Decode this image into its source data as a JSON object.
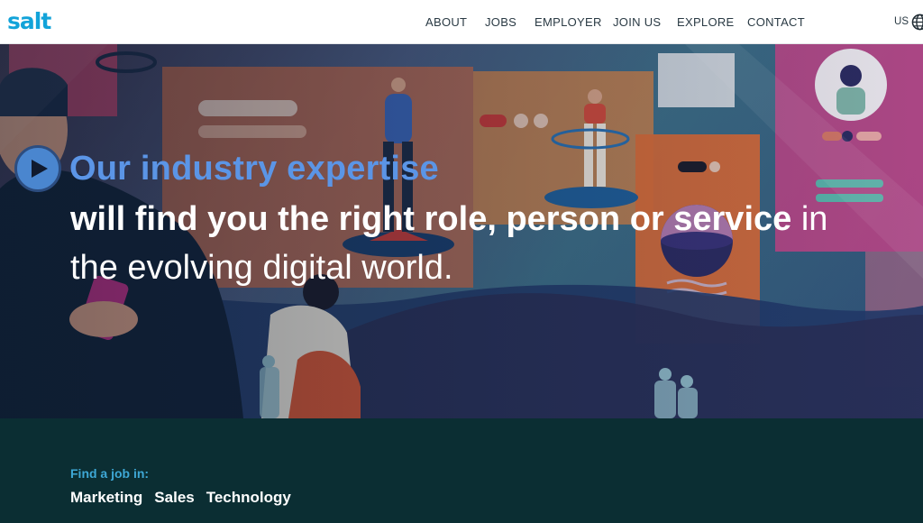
{
  "brand": {
    "logo_text": "salt",
    "color": "#12a3d9"
  },
  "nav": {
    "items": [
      {
        "label": "ABOUT"
      },
      {
        "label": "JOBS"
      },
      {
        "label": "EMPLOYER"
      },
      {
        "label": "JOIN US"
      },
      {
        "label": "EXPLORE"
      },
      {
        "label": "CONTACT"
      }
    ],
    "region_label": "US",
    "region_icon": "globe-icon"
  },
  "hero": {
    "play_icon": "play-icon",
    "headline_accent": "Our industry expertise",
    "headline_bold": "will find you the right role, person or service",
    "headline_rest": " in",
    "headline_line3": "the evolving digital world.",
    "accent_color": "#5b95e6"
  },
  "jobs_band": {
    "find_label": "Find a job in:",
    "links": [
      {
        "label": "Marketing"
      },
      {
        "label": "Sales"
      },
      {
        "label": "Technology"
      }
    ],
    "background_color": "#0b2e33",
    "label_color": "#3ea8d6"
  }
}
